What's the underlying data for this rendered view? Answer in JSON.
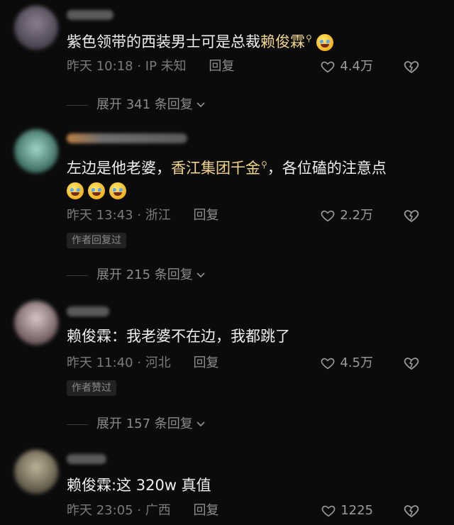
{
  "comments": [
    {
      "text_prefix": "紫色领带的西装男士可是总裁",
      "mention": "赖俊霖",
      "text_suffix": "",
      "time_location": "昨天 10:18 · IP 未知",
      "reply_label": "回复",
      "likes": "4.4万",
      "expand_label": "展开 341 条回复"
    },
    {
      "text_prefix": "左边是他老婆，",
      "mention": "香江集团千金",
      "text_suffix": "，各位磕的注意点",
      "time_location": "昨天 13:43 · 浙江",
      "reply_label": "回复",
      "likes": "2.2万",
      "tag": "作者回复过",
      "expand_label": "展开 215 条回复"
    },
    {
      "text_prefix": "赖俊霖：我老婆不在边，我都跳了",
      "time_location": "昨天 11:40 · 河北",
      "reply_label": "回复",
      "likes": "4.5万",
      "tag": "作者赞过",
      "expand_label": "展开 157 条回复"
    },
    {
      "text_prefix": "赖俊霖:这 320w 真值",
      "time_location": "昨天 23:05 · 广西",
      "reply_label": "回复",
      "likes": "1225"
    }
  ],
  "colors": {
    "background": "#0b0b0b",
    "mention": "#f2d58c",
    "meta": "#7a7a7a"
  },
  "icons": [
    "search-icon",
    "heart-icon",
    "broken-heart-icon",
    "chevron-down-icon",
    "emoji-icon"
  ]
}
